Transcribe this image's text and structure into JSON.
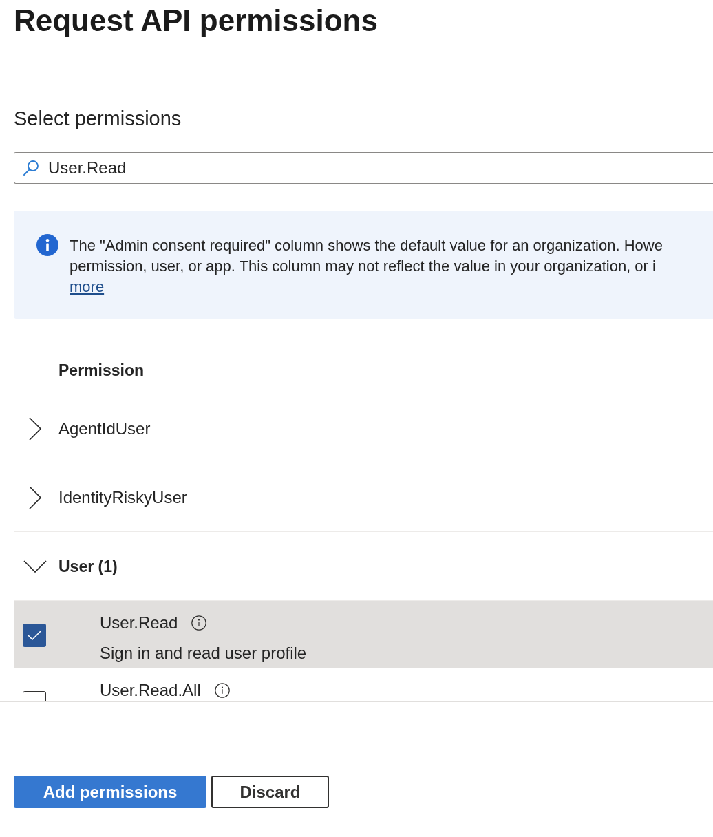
{
  "page_title": "Request API permissions",
  "section_title": "Select permissions",
  "search": {
    "value": "User.Read"
  },
  "info_banner": {
    "lines": [
      "The \"Admin consent required\" column shows the default value for an organization. Howe",
      "permission, user, or app. This column may not reflect the value in your organization, or i"
    ],
    "link": "more"
  },
  "table": {
    "columns": [
      "Permission"
    ],
    "groups": [
      {
        "name": "AgentIdUser",
        "expanded": false
      },
      {
        "name": "IdentityRiskyUser",
        "expanded": false
      },
      {
        "name": "User (1)",
        "expanded": true,
        "permissions": [
          {
            "name": "User.Read",
            "description": "Sign in and read user profile",
            "checked": true,
            "selected": true
          },
          {
            "name": "User.Read.All",
            "checked": false,
            "selected": false
          }
        ]
      }
    ]
  },
  "buttons": [
    {
      "label": "Add permissions",
      "kind": "primary"
    },
    {
      "label": "Discard",
      "kind": "secondary"
    }
  ]
}
